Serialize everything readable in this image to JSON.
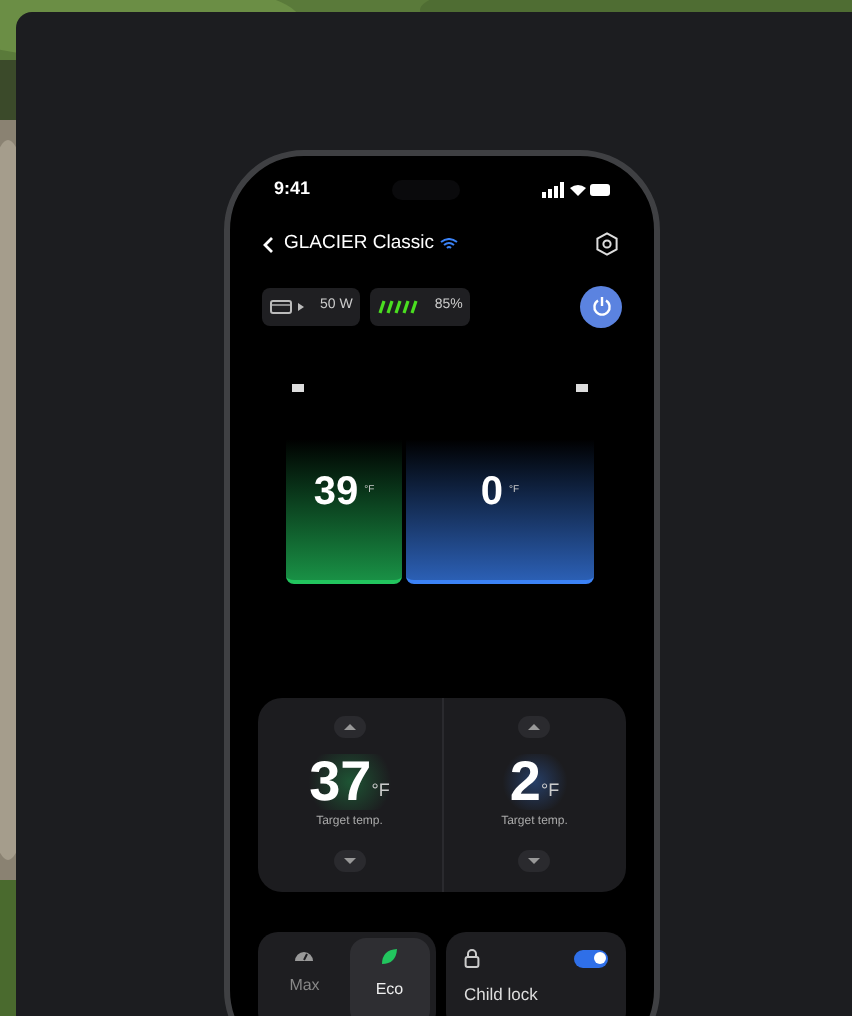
{
  "status_bar": {
    "time": "9:41"
  },
  "header": {
    "title": "GLACIER Classic"
  },
  "chips": [
    {
      "kind": "input",
      "text": "50 W"
    },
    {
      "kind": "battery",
      "text": "85%"
    }
  ],
  "power": {
    "on": true
  },
  "compartments": [
    {
      "reading": "39",
      "unit": "°F",
      "color": "#22c55e"
    },
    {
      "reading": "0",
      "unit": "°F",
      "color": "#3b82f6"
    }
  ],
  "zones": [
    {
      "value": "37",
      "unit": "°F",
      "label": "Target temp."
    },
    {
      "value": "2",
      "unit": "°F",
      "label": "Target temp."
    }
  ],
  "modes": [
    {
      "label": "Max",
      "selected": false,
      "kind": "gauge"
    },
    {
      "label": "Eco",
      "selected": true,
      "kind": "leaf"
    }
  ],
  "child_lock": {
    "label": "Child lock",
    "on": true
  }
}
